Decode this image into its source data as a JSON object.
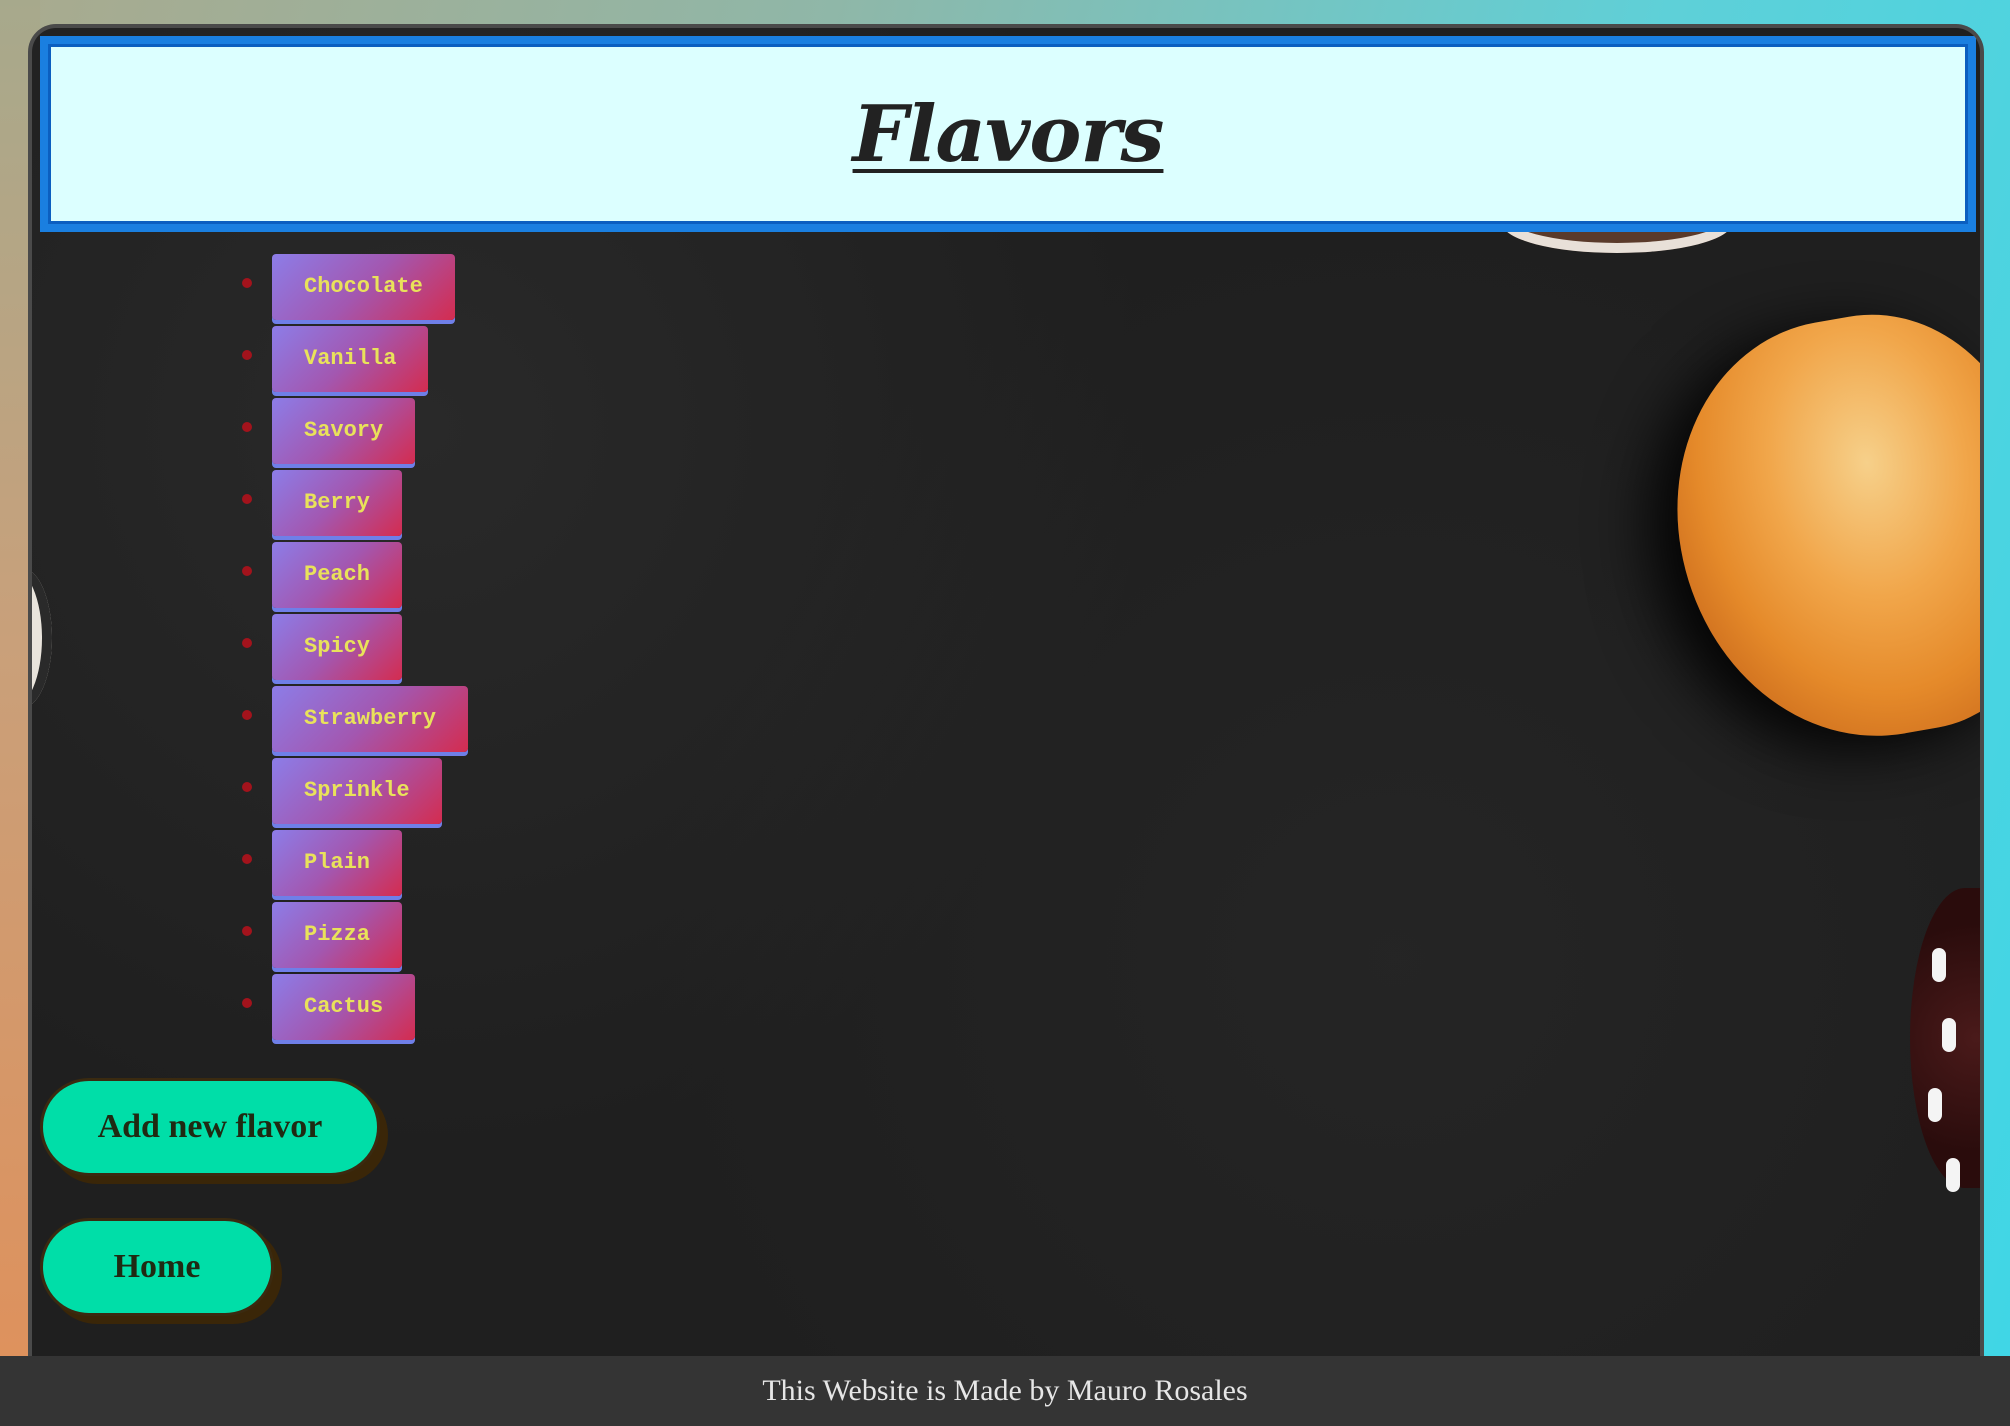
{
  "header": {
    "title": "Flavors"
  },
  "flavors": [
    "Chocolate",
    "Vanilla",
    "Savory",
    "Berry",
    "Peach",
    "Spicy",
    "Strawberry",
    "Sprinkle",
    "Plain",
    "Pizza",
    "Cactus"
  ],
  "actions": {
    "add_label": "Add new flavor",
    "home_label": "Home"
  },
  "footer": {
    "text": "This Website is Made by Mauro Rosales"
  },
  "colors": {
    "header_bg": "#dcffff",
    "header_border": "#1a7fe0",
    "flavor_text": "#e9e25a",
    "action_bg": "#00dea8",
    "footer_bg": "#343434"
  }
}
